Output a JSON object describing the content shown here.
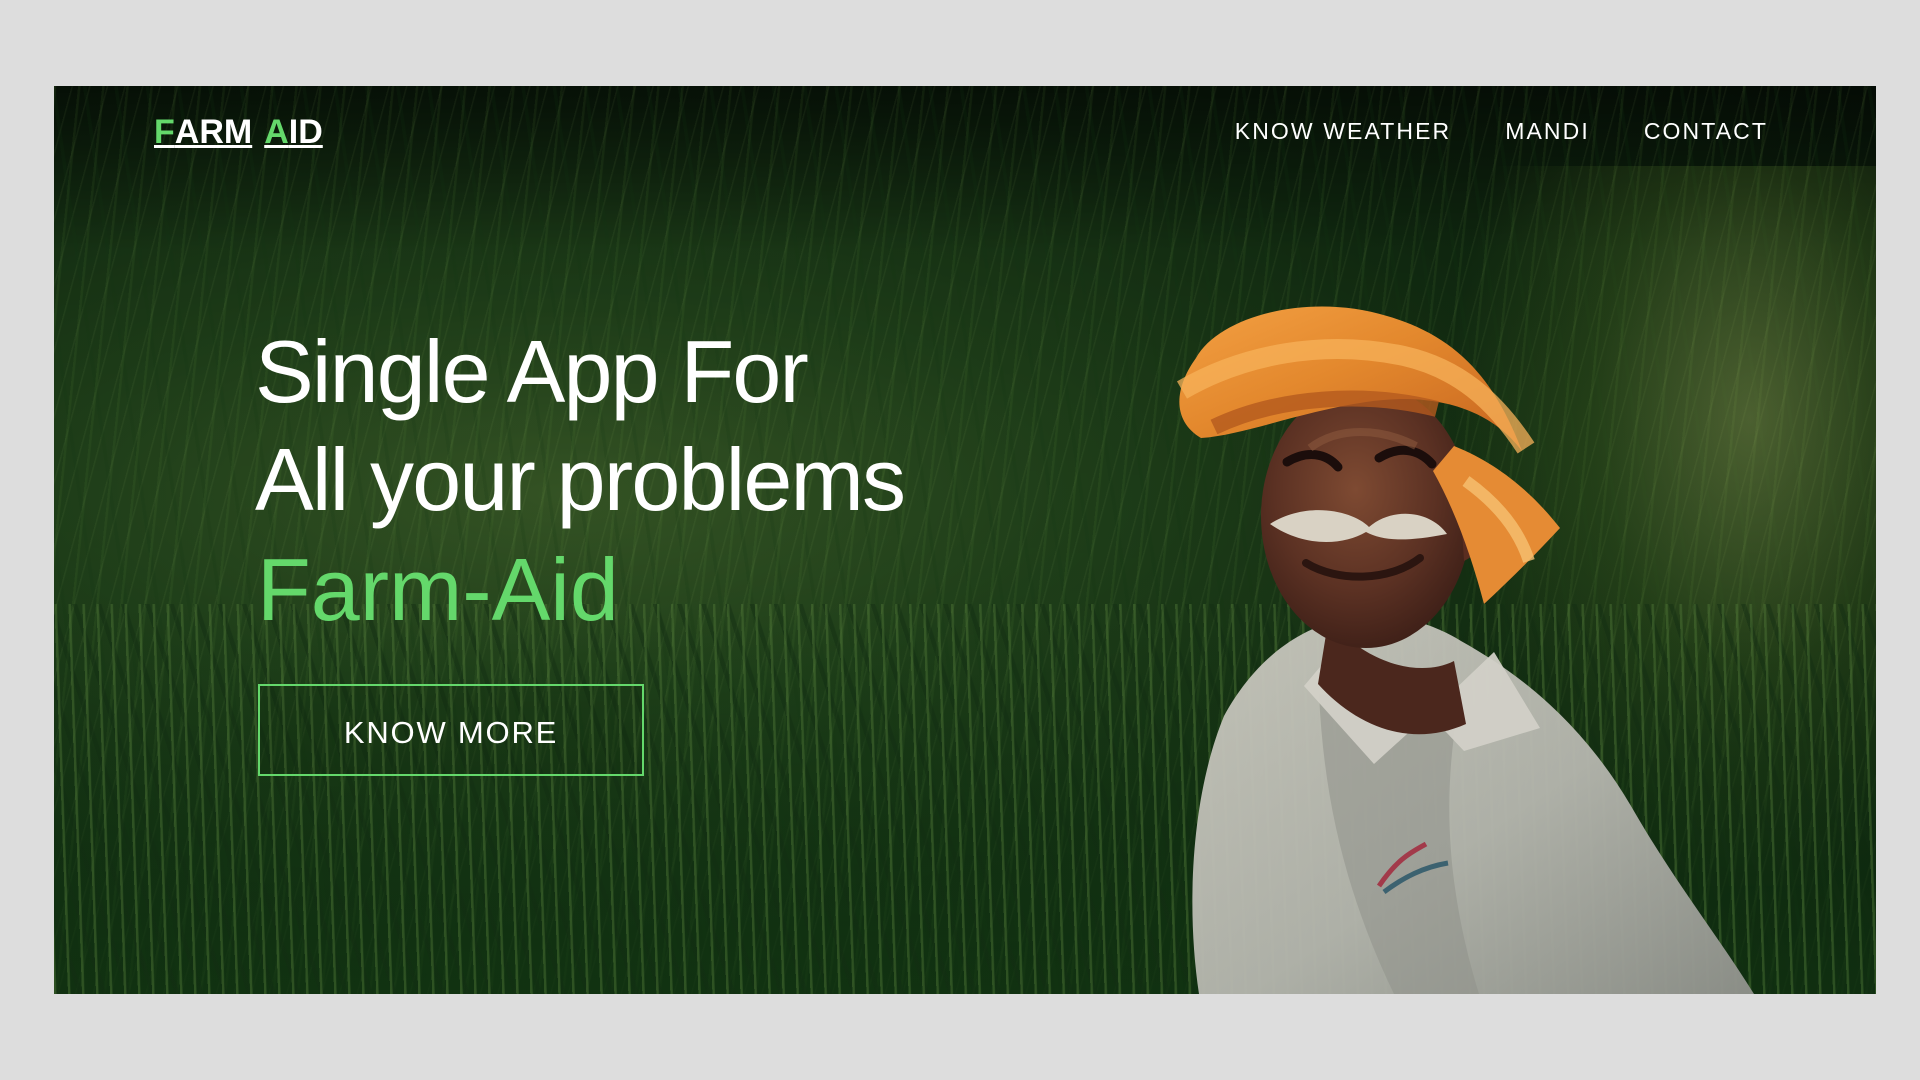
{
  "brand": {
    "logo_first_letter": "F",
    "logo_first_rest": "ARM",
    "logo_second_letter": "A",
    "logo_second_rest": "ID",
    "accent_color": "#64d86b"
  },
  "nav": {
    "items": [
      {
        "label": "KNOW WEATHER"
      },
      {
        "label": "MANDI"
      },
      {
        "label": "CONTACT"
      }
    ]
  },
  "hero": {
    "line_1": "Single App For",
    "line_2": "All your problems",
    "brand_line": "Farm-Aid",
    "cta_label": "KNOW MORE"
  },
  "visual": {
    "background_theme": "green wheat field",
    "subject": "smiling farmer with orange turban"
  }
}
